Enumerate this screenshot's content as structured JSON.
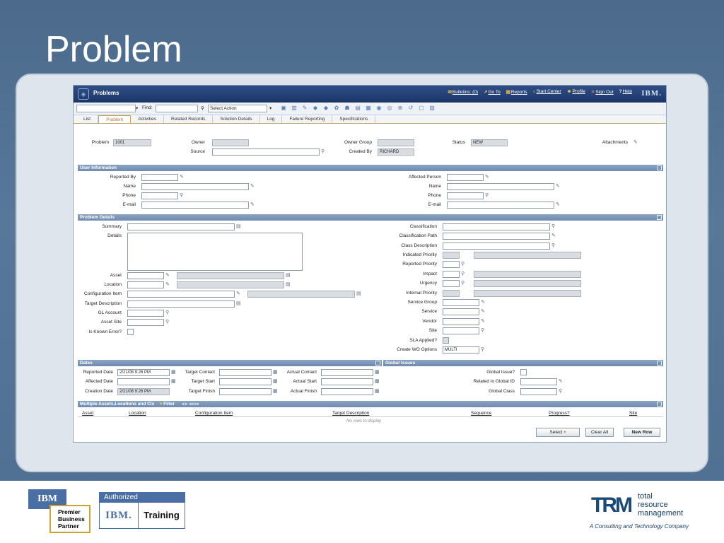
{
  "slide": {
    "title": "Problem"
  },
  "app": {
    "title": "Problems",
    "header_links": [
      "Bulletins: (0)",
      "Go To",
      "Reports",
      "Start Center",
      "Profile",
      "Sign Out",
      "Help"
    ],
    "brand": "IBM."
  },
  "toolbar": {
    "find_label": "Find:",
    "action_select": "Select Action"
  },
  "tabs": [
    "List",
    "Problem",
    "Activities",
    "Related Records",
    "Solution Details",
    "Log",
    "Failure Reporting",
    "Specifications"
  ],
  "header_fields": {
    "problem_label": "Problem",
    "problem_value": "1001",
    "owner_label": "Owner",
    "source_label": "Source",
    "owner_group_label": "Owner Group",
    "created_by_label": "Created By",
    "created_by_value": "RICHARD",
    "status_label": "Status",
    "status_value": "NEW",
    "attachments_label": "Attachments"
  },
  "user_info": {
    "title": "User Information",
    "left": [
      "Reported By",
      "Name",
      "Phone",
      "E-mail"
    ],
    "right": [
      "Affected Person",
      "Name",
      "Phone",
      "E-mail"
    ]
  },
  "problem_details": {
    "title": "Problem Details",
    "left": [
      "Summary",
      "Details",
      "Asset",
      "Location",
      "Configuration Item",
      "Target Description",
      "GL Account",
      "Asset Site",
      "Is Known Error?"
    ],
    "right": [
      "Classification",
      "Classification Path",
      "Class Description",
      "Indicated Priority",
      "Reported Priority",
      "Impact",
      "Urgency",
      "Internal Priority",
      "Service Group",
      "Service",
      "Vendor",
      "Site",
      "SLA Applied?",
      "Create WO Options"
    ],
    "wo_option_value": "MULTI"
  },
  "dates": {
    "title": "Dates",
    "col1": [
      "Reported Date",
      "Affected Date",
      "Creation Date"
    ],
    "col1_values": [
      "2/21/08 9:26 PM",
      "",
      "2/21/08 9:26 PM"
    ],
    "col2": [
      "Target Contact",
      "Target Start",
      "Target Finish"
    ],
    "col3": [
      "Actual Contact",
      "Actual Start",
      "Actual Finish"
    ]
  },
  "global_issues": {
    "title": "Global Issues",
    "fields": [
      "Global Issue?",
      "Related to Global ID",
      "Global Class"
    ]
  },
  "multi_assets": {
    "title": "Multiple Assets,Locations and CIs",
    "filter_label": "Filter",
    "columns": [
      "Asset",
      "Location",
      "Configuration Item",
      "Target Description",
      "Sequence",
      "Progress?",
      "Site"
    ],
    "empty_text": "No rows to display",
    "buttons": {
      "select": "Select",
      "clear_all": "Clear All",
      "new_row": "New Row"
    }
  },
  "footer": {
    "ibm_badge": {
      "brand": "IBM",
      "line1": "Premier",
      "line2": "Business",
      "line3": "Partner"
    },
    "training_badge": {
      "top": "Authorized",
      "brand": "IBM.",
      "label": "Training"
    },
    "trm": {
      "mark": "TRM",
      "w1": "total",
      "w2": "resource",
      "w3": "management",
      "tagline": "A Consulting and Technology Company"
    }
  }
}
